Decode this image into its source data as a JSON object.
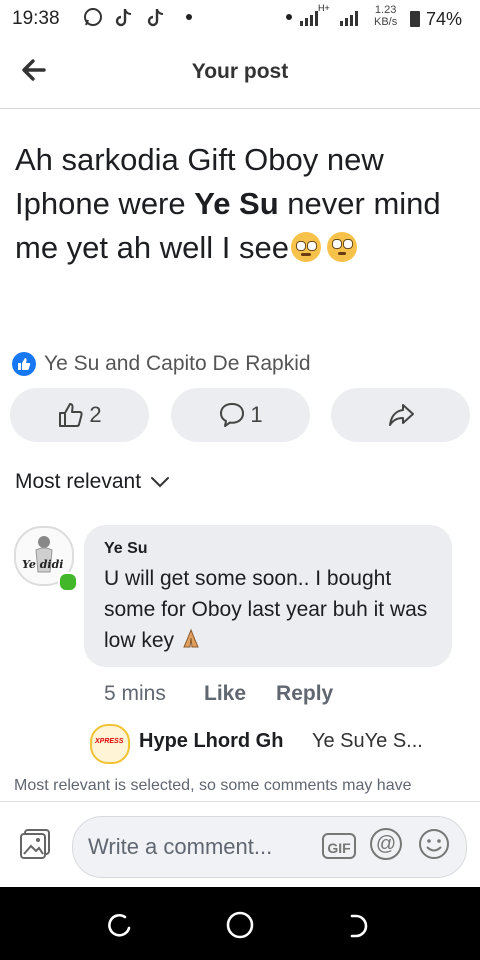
{
  "status_bar": {
    "time": "19:38",
    "icons": [
      "whatsapp-icon",
      "tiktok-icon",
      "tiktok-icon",
      "notification-dot"
    ],
    "network": "H+",
    "speed_value": "1.23",
    "speed_unit": "KB/s",
    "battery": "74%"
  },
  "header": {
    "title": "Your post",
    "back_icon": "arrow-left-icon"
  },
  "post": {
    "text_before": "Ah sarkodia Gift Oboy new Iphone were ",
    "mention": "Ye Su",
    "text_after": " never mind me yet ah well I see",
    "emojis": [
      "pleading-face-emoji",
      "rolling-eyes-emoji"
    ]
  },
  "reactions": {
    "text": "Ye Su and Capito De Rapkid",
    "icon": "like-badge-icon"
  },
  "actions": {
    "like_count": "2",
    "comment_count": "1"
  },
  "filter": {
    "label": "Most relevant"
  },
  "comment": {
    "avatar_text": "Ye didi",
    "author": "Ye Su",
    "text": "U will get some soon.. I bought some for Oboy last year buh it was low key",
    "emoji": "folded-hands-emoji",
    "time": "5 mins",
    "like_label": "Like",
    "reply_label": "Reply"
  },
  "reply_preview": {
    "avatar_text": "XPRESS",
    "name": "Hype Lhord Gh",
    "text": "Ye SuYe S..."
  },
  "note": "Most relevant is selected, so some comments may have",
  "composer": {
    "placeholder": "Write a comment...",
    "gif_label": "GIF",
    "at_label": "@"
  },
  "colors": {
    "accent": "#1877f2",
    "bubble": "#ebedf0",
    "online": "#42b72a"
  }
}
